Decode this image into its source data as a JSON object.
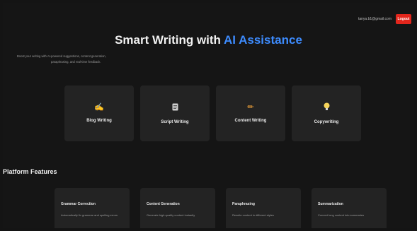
{
  "header": {
    "user_email": "tanya.b1@gmail.com",
    "logout_label": "Logout"
  },
  "hero": {
    "title_main": "Smart Writing with ",
    "title_accent": "AI Assistance",
    "subtitle_line1": "Boost your writing with AI-powered suggestions, content generation,",
    "subtitle_line2": "paraphrasing, and real-time feedback."
  },
  "tools": [
    {
      "label": "Blog Writing",
      "icon": "hand-writing-icon",
      "glyph": "✍",
      "color": "#f3a33a"
    },
    {
      "label": "Script Writing",
      "icon": "script-icon",
      "glyph": "📜",
      "color": "#d7d7d7"
    },
    {
      "label": "Content Writing",
      "icon": "pencil-icon",
      "glyph": "✏",
      "color": "#f0a23a"
    },
    {
      "label": "Copywriting",
      "icon": "lightbulb-icon",
      "glyph": "💡",
      "color": "#f5d35a"
    }
  ],
  "features_section": {
    "title": "Platform Features"
  },
  "features": [
    {
      "title": "Grammar Correction",
      "desc": "Automatically fix grammar and spelling errors"
    },
    {
      "title": "Content Generation",
      "desc": "Generate high-quality content instantly"
    },
    {
      "title": "Paraphrasing",
      "desc": "Rewrite content in different styles"
    },
    {
      "title": "Summarization",
      "desc": "Convert long content into summaries"
    }
  ],
  "colors": {
    "accent": "#3d8bfd",
    "logout": "#e3261c",
    "background": "#151515",
    "card": "#232323"
  }
}
